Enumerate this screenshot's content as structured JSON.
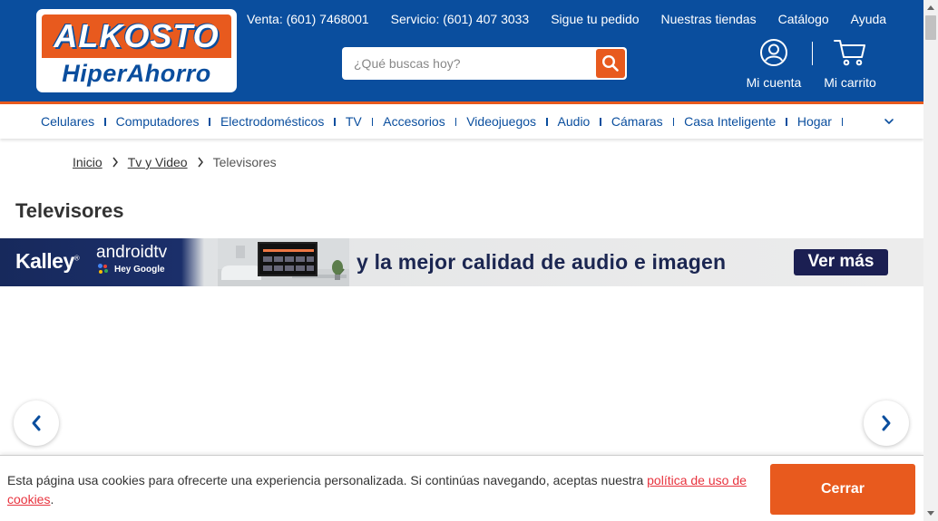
{
  "header": {
    "logo_top": "ALKOSTO",
    "logo_bottom": "HiperAhorro",
    "top_links": [
      "Venta: (601) 7468001",
      "Servicio: (601) 407 3033",
      "Sigue tu pedido",
      "Nuestras tiendas",
      "Catálogo",
      "Ayuda"
    ],
    "search_placeholder": "¿Qué buscas hoy?",
    "account_label": "Mi cuenta",
    "cart_label": "Mi carrito"
  },
  "nav": {
    "categories": [
      "Celulares",
      "Computadores",
      "Electrodomésticos",
      "TV",
      "Accesorios",
      "Videojuegos",
      "Audio",
      "Cámaras",
      "Casa Inteligente",
      "Hogar"
    ]
  },
  "breadcrumb": {
    "items": [
      "Inicio",
      "Tv y Video"
    ],
    "current": "Televisores"
  },
  "page": {
    "title": "Televisores"
  },
  "banner": {
    "brand": "Kalley",
    "android": "androidtv",
    "hey_google": "Hey Google",
    "headline": "y la mejor calidad de audio e imagen",
    "cta": "Ver más"
  },
  "cookie": {
    "text": "Esta página usa cookies para ofrecerte una experiencia personalizada. Si continúas navegando, aceptas nuestra ",
    "link": "política de uso de cookies",
    "end": ".",
    "button": "Cerrar"
  },
  "colors": {
    "brand_blue": "#0a4e9e",
    "brand_orange": "#e85a1e",
    "cookie_link": "#e8333e"
  }
}
